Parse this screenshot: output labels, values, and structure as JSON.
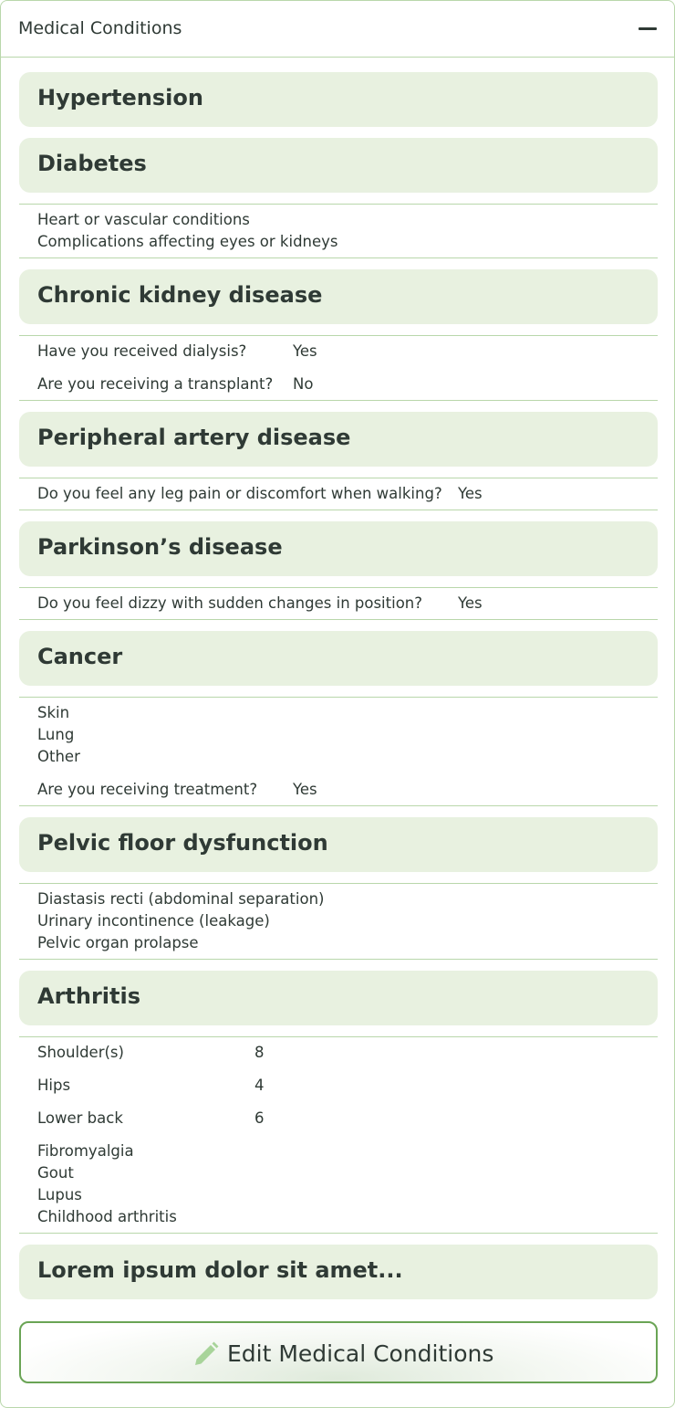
{
  "header": {
    "title": "Medical Conditions"
  },
  "conditions": [
    {
      "title": "Hypertension"
    },
    {
      "title": "Diabetes",
      "items": [
        "Heart or vascular conditions",
        "Complications affecting eyes or kidneys"
      ]
    },
    {
      "title": "Chronic kidney disease",
      "questions": [
        {
          "q": "Have you received dialysis?",
          "a": "Yes"
        },
        {
          "q": "Are you receiving a transplant?",
          "a": "No"
        }
      ]
    },
    {
      "title": "Peripheral artery disease",
      "questions": [
        {
          "q": "Do you feel any leg pain or discomfort when walking?",
          "a": "Yes"
        }
      ]
    },
    {
      "title": "Parkinson’s disease",
      "questions": [
        {
          "q": "Do you feel dizzy with sudden changes in position?",
          "a": "Yes"
        }
      ]
    },
    {
      "title": "Cancer",
      "items": [
        "Skin",
        "Lung",
        "Other"
      ],
      "questions": [
        {
          "q": "Are you receiving treatment?",
          "a": "Yes"
        }
      ]
    },
    {
      "title": "Pelvic floor dysfunction",
      "items": [
        "Diastasis recti (abdominal separation)",
        "Urinary incontinence (leakage)",
        "Pelvic organ prolapse"
      ]
    },
    {
      "title": "Arthritis",
      "ratings": [
        {
          "label": "Shoulder(s)",
          "value": "8"
        },
        {
          "label": "Hips",
          "value": "4"
        },
        {
          "label": "Lower back",
          "value": "6"
        }
      ],
      "items": [
        "Fibromyalgia",
        "Gout",
        "Lupus",
        "Childhood arthritis"
      ]
    },
    {
      "title": "Lorem ipsum dolor sit amet..."
    }
  ],
  "edit_button": {
    "label": "Edit Medical Conditions",
    "icon": "pencil-icon"
  },
  "colors": {
    "accent": "#6aa455",
    "card_bg": "#e8f1e0",
    "border": "#b9d7ab",
    "text": "#2f3a35",
    "pencil": "#a8d49a"
  }
}
